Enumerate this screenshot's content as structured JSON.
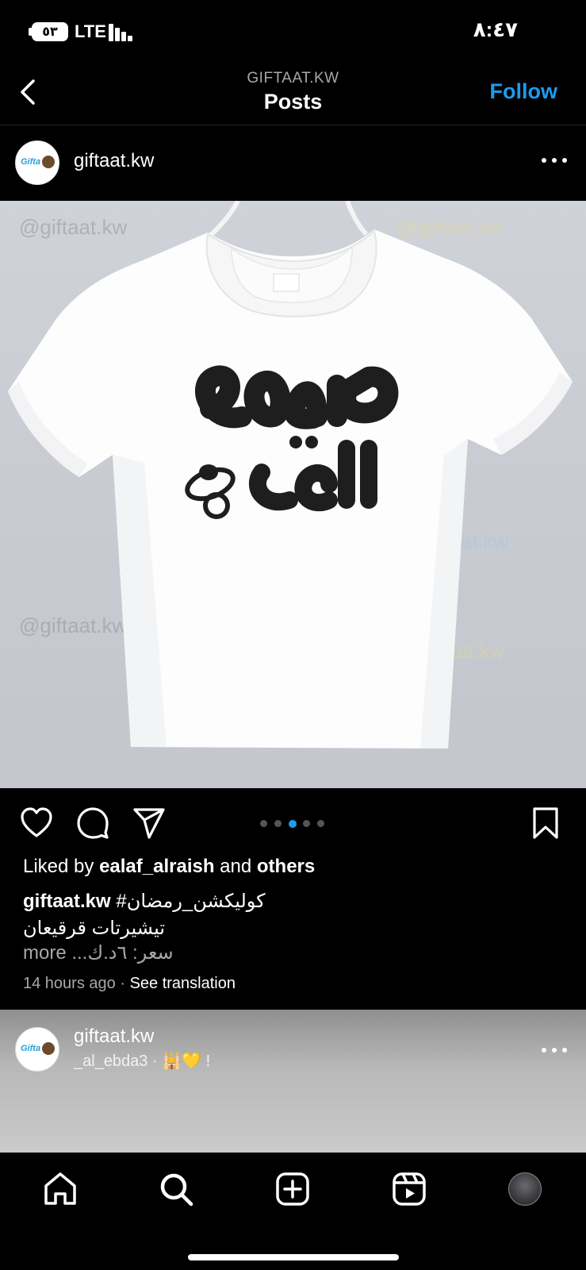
{
  "status_bar": {
    "battery": "٥٣",
    "network": "LTE",
    "time": "٨:٤٧"
  },
  "header": {
    "subtitle": "GIFTAAT.KW",
    "title": "Posts",
    "follow_label": "Follow",
    "accent_color": "#1d9bf0"
  },
  "post": {
    "username": "giftaat.kw",
    "avatar_text": "Gifta",
    "watermark": "@giftaat.kw",
    "carousel": {
      "count": 5,
      "active_index": 2
    },
    "liked_prefix": "Liked by",
    "liked_user": "ealaf_alraish",
    "liked_and": "and",
    "liked_others": "others",
    "caption_user": "giftaat.kw",
    "caption_hashtag": "#كوليكشن_رمضان",
    "caption_line2": "تيشيرتات قرقيعان",
    "caption_line3": "more ...سعر: ٦د.ك",
    "time_ago": "14 hours ago",
    "separator": "·",
    "see_translation": "See translation"
  },
  "next_post": {
    "username": "giftaat.kw",
    "subtitle": "_al_ebda3 · 🕌💛 !",
    "avatar_text": "Gifta"
  },
  "icons": {
    "back": "chevron-left-icon",
    "more": "more-horizontal-icon",
    "like": "heart-icon",
    "comment": "comment-icon",
    "share": "send-icon",
    "save": "bookmark-icon",
    "home": "home-icon",
    "search": "search-icon",
    "create": "plus-square-icon",
    "reels": "reels-icon"
  }
}
